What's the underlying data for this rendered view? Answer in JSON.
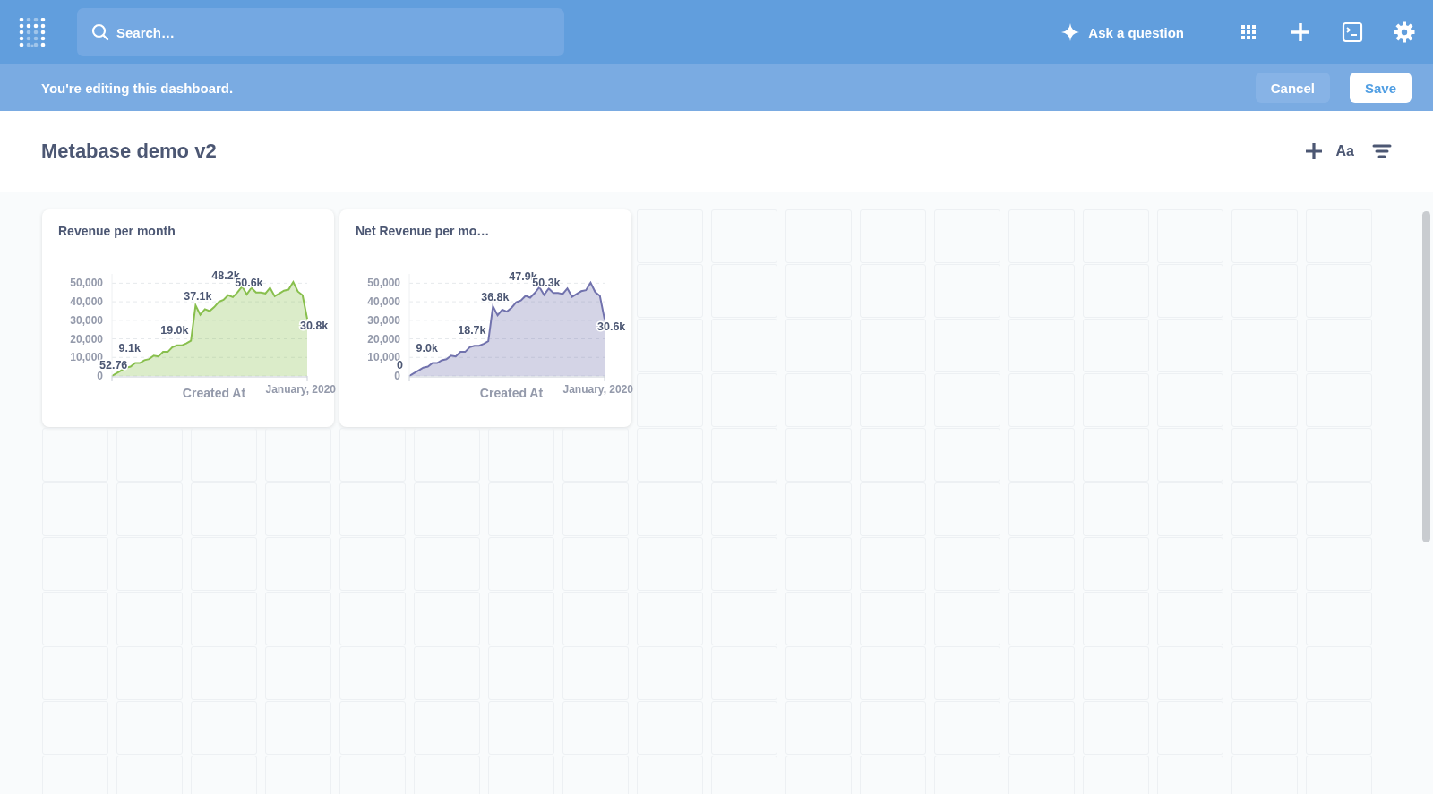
{
  "top_bar": {
    "search": {
      "placeholder": "Search…"
    },
    "ask_button": {
      "label": "Ask a question"
    }
  },
  "edit_bar": {
    "message": "You're editing this dashboard.",
    "buttons": [
      {
        "label": "Cancel",
        "kind": "secondary"
      },
      {
        "label": "Save",
        "kind": "primary"
      }
    ]
  },
  "dashboard": {
    "title": "Metabase demo v2",
    "text_button": "Aa"
  },
  "cards": [
    {
      "title": "Revenue per month",
      "x_end_label": "January, 2020",
      "point_labels": [
        "52.76",
        "9.1k",
        "19.0k",
        "37.1k",
        "48.2k",
        "50.6k",
        "30.8k"
      ],
      "chart_data": {
        "type": "area",
        "xlabel": "Created At",
        "grid": true,
        "ylim": [
          0,
          55000
        ],
        "yticks": [
          {
            "value": 0,
            "label": "0"
          },
          {
            "value": 10000,
            "label": "10,000"
          },
          {
            "value": 20000,
            "label": "20,000"
          },
          {
            "value": 30000,
            "label": "30,000"
          },
          {
            "value": 40000,
            "label": "40,000"
          },
          {
            "value": 50000,
            "label": "50,000"
          }
        ],
        "series": [
          {
            "color": "#88bf4d",
            "values": [
              0,
              1500,
              3000,
              4500,
              5000,
              7000,
              7000,
              8500,
              9100,
              11000,
              10500,
              13000,
              13000,
              15500,
              16500,
              16500,
              17500,
              19000,
              38000,
              33000,
              36000,
              35000,
              37100,
              40000,
              41000,
              43500,
              42500,
              45000,
              48200,
              44000,
              47500,
              45000,
              45000,
              44500,
              47500,
              43000,
              44500,
              46000,
              46500,
              50600,
              45500,
              43500,
              30800
            ]
          }
        ]
      }
    },
    {
      "title": "Net Revenue per mo…",
      "x_end_label": "January, 2020",
      "point_labels": [
        "0",
        "9.0k",
        "18.7k",
        "36.8k",
        "47.9k",
        "50.3k",
        "30.6k"
      ],
      "chart_data": {
        "type": "area",
        "xlabel": "Created At",
        "grid": true,
        "ylim": [
          0,
          55000
        ],
        "yticks": [
          {
            "value": 0,
            "label": "0"
          },
          {
            "value": 10000,
            "label": "10,000"
          },
          {
            "value": 20000,
            "label": "20,000"
          },
          {
            "value": 30000,
            "label": "30,000"
          },
          {
            "value": 40000,
            "label": "40,000"
          },
          {
            "value": 50000,
            "label": "50,000"
          }
        ],
        "series": [
          {
            "color": "#7172ad",
            "values": [
              0,
              1500,
              3000,
              4500,
              5000,
              7000,
              7000,
              8500,
              9000,
              11000,
              10500,
              13000,
              13000,
              15500,
              16300,
              16300,
              17300,
              18700,
              37500,
              32700,
              35700,
              34700,
              36800,
              39700,
              40700,
              43200,
              42200,
              44700,
              47900,
              43700,
              47200,
              44700,
              44700,
              44200,
              47200,
              42700,
              44200,
              45700,
              46200,
              50300,
              45200,
              43200,
              30600
            ]
          }
        ]
      }
    }
  ]
}
